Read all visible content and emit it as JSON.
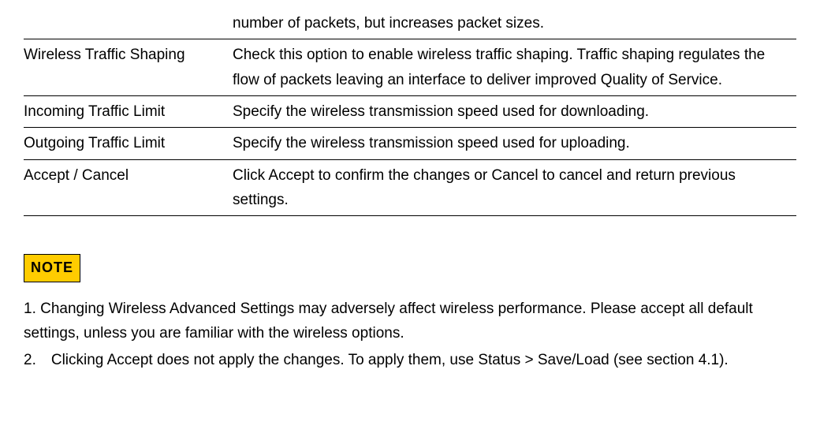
{
  "table": {
    "rows": [
      {
        "label": "",
        "desc": "number of packets, but increases packet sizes."
      },
      {
        "label": "Wireless Traffic Shaping",
        "desc": "Check this option to enable wireless traffic shaping. Traffic shaping regulates the flow of packets leaving an interface to deliver improved Quality of Service."
      },
      {
        "label": "Incoming Traffic Limit",
        "desc": "Specify the wireless transmission speed used for downloading."
      },
      {
        "label": "Outgoing Traffic Limit",
        "desc": "Specify the wireless transmission speed used for uploading."
      },
      {
        "label": "Accept / Cancel",
        "desc": "Click Accept to confirm the changes or Cancel to cancel and return previous settings."
      }
    ]
  },
  "note": {
    "badge": "NOTE",
    "item1": "1. Changing Wireless Advanced Settings may adversely affect wireless performance. Please accept all default settings, unless you are familiar with the wireless options.",
    "item2": "2. Clicking Accept does not apply the changes. To apply them, use Status > Save/Load (see section 4.1)."
  }
}
